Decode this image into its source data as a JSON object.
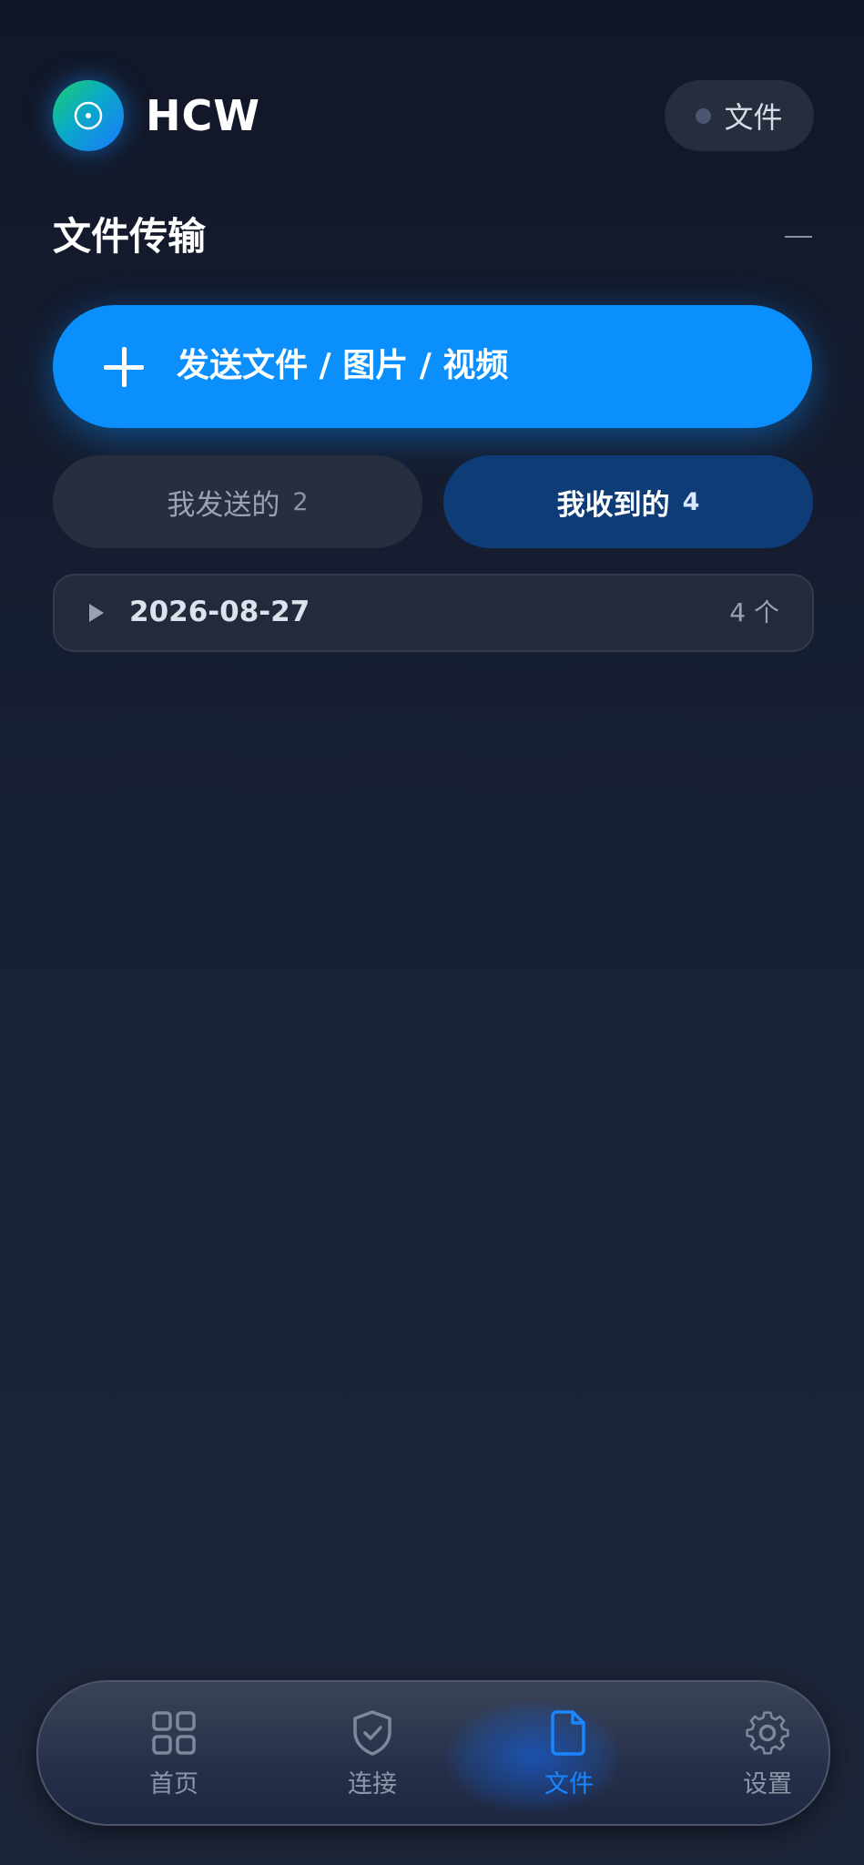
{
  "header": {
    "app_title": "HCW",
    "status_label": "文件"
  },
  "section": {
    "title": "文件传输",
    "collapse_icon": "minus-icon"
  },
  "send_button": {
    "label": "发送文件 / 图片 / 视频",
    "icon": "plus-icon"
  },
  "tabs": [
    {
      "label": "我发送的",
      "count": "2",
      "active": false
    },
    {
      "label": "我收到的",
      "count": "4",
      "active": true
    }
  ],
  "groups": [
    {
      "date": "2026-08-27",
      "count_label": "4 个",
      "expanded": false
    }
  ],
  "nav": {
    "items": [
      {
        "label": "首页",
        "icon": "grid-icon",
        "active": false
      },
      {
        "label": "连接",
        "icon": "shield-check-icon",
        "active": false
      },
      {
        "label": "文件",
        "icon": "file-icon",
        "active": true
      },
      {
        "label": "设置",
        "icon": "gear-icon",
        "active": false
      }
    ]
  },
  "colors": {
    "accent": "#0a8ffd",
    "active_tab": "#0e3c76",
    "background": "#151c2e"
  }
}
